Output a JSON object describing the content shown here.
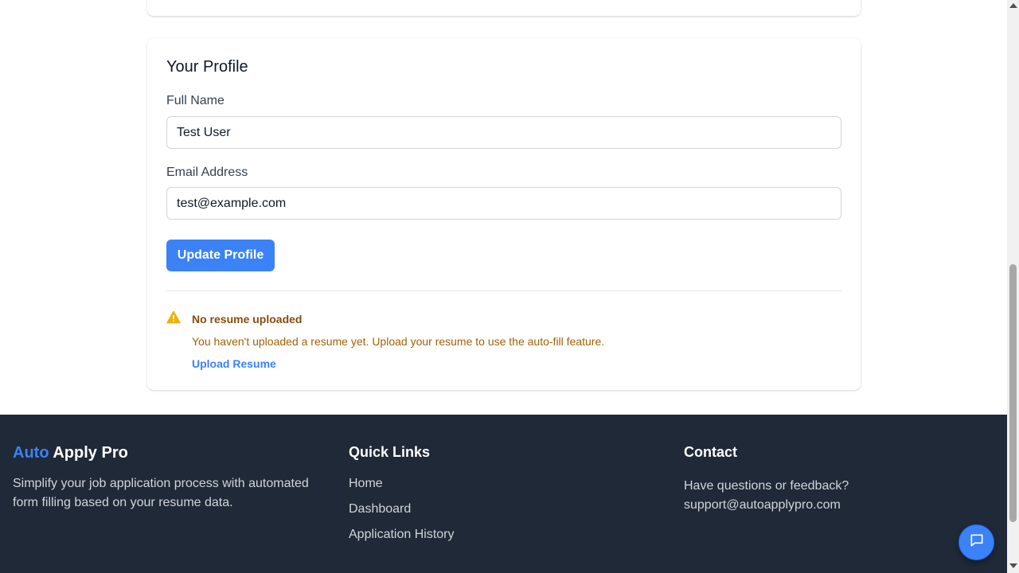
{
  "profile": {
    "title": "Your Profile",
    "full_name_label": "Full Name",
    "full_name_value": "Test User",
    "email_label": "Email Address",
    "email_value": "test@example.com",
    "update_button": "Update Profile"
  },
  "alert": {
    "icon": "warning-icon",
    "title": "No resume uploaded",
    "text": "You haven't uploaded a resume yet. Upload your resume to use the auto-fill feature.",
    "link": "Upload Resume"
  },
  "footer": {
    "brand_accent": "Auto",
    "brand_rest": " Apply Pro",
    "description": "Simplify your job application process with automated form filling based on your resume data.",
    "quick_links_title": "Quick Links",
    "quick_links": [
      "Home",
      "Dashboard",
      "Application History"
    ],
    "contact_title": "Contact",
    "contact_question": "Have questions or feedback?",
    "contact_email": "support@autoapplypro.com"
  },
  "chat": {
    "icon": "chat-bubble-icon"
  },
  "colors": {
    "accent": "#3b82f6",
    "footer_bg": "#1f2937",
    "warning": "#eab308",
    "warning_text": "#a16207"
  }
}
